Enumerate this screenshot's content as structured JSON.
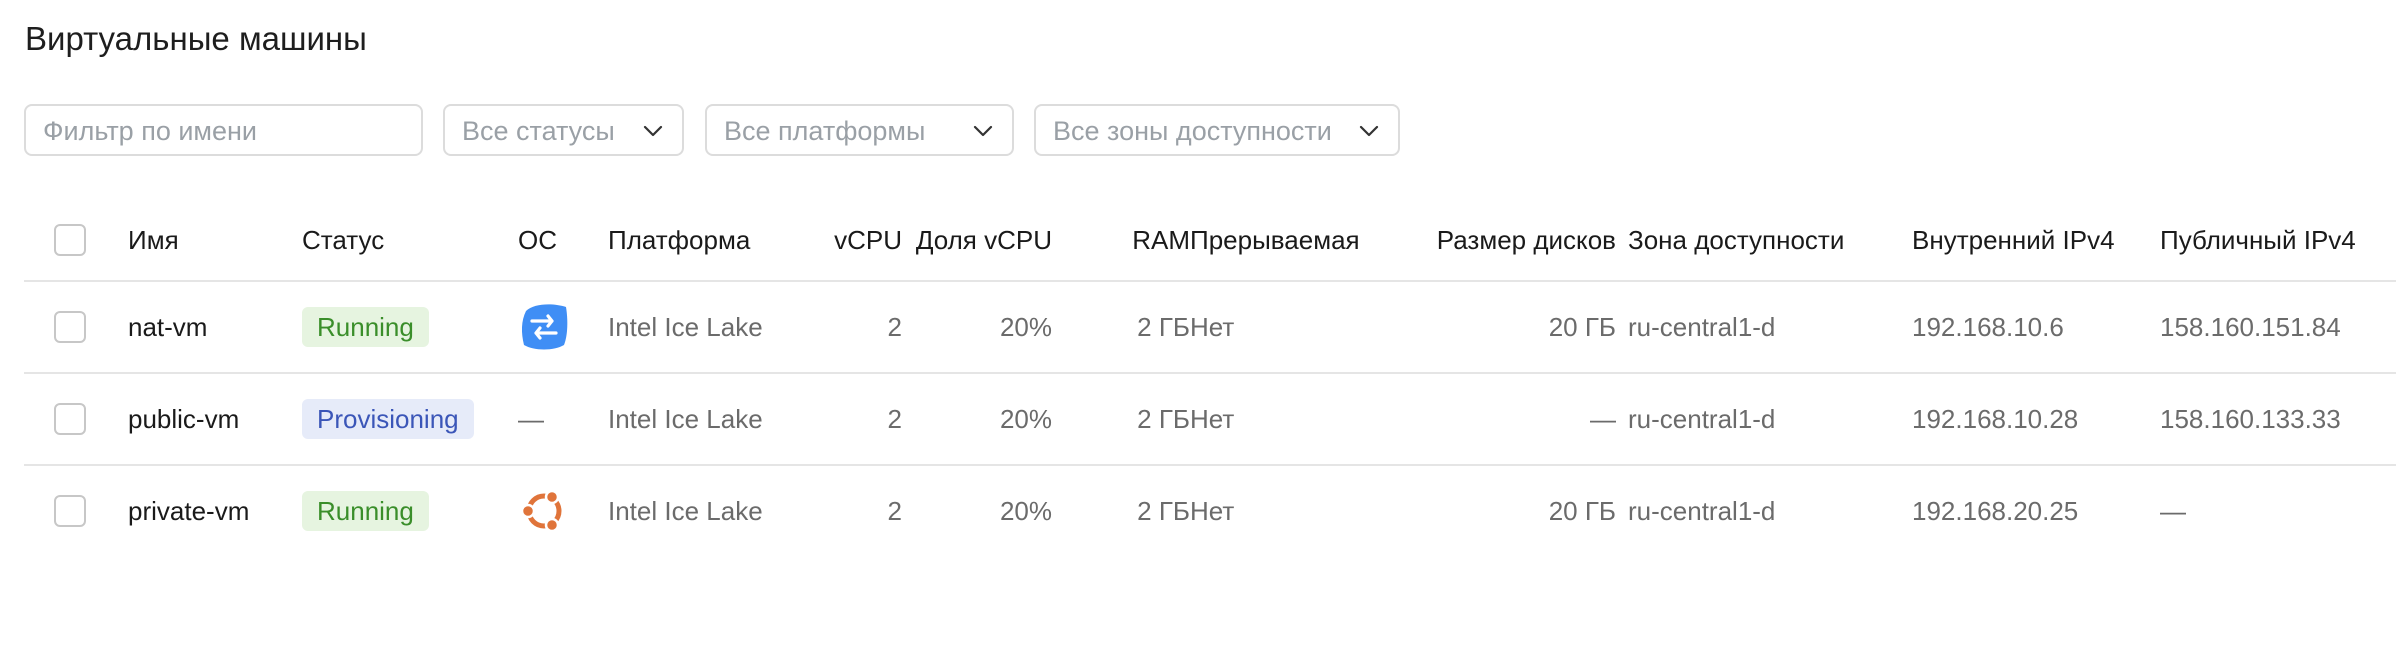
{
  "page": {
    "title": "Виртуальные машины"
  },
  "filters": {
    "name_placeholder": "Фильтр по имени",
    "status": "Все статусы",
    "platform": "Все платформы",
    "zone": "Все зоны доступности"
  },
  "table": {
    "headers": {
      "name": "Имя",
      "status": "Статус",
      "os": "ОС",
      "platform": "Платформа",
      "vcpu": "vCPU",
      "vcpu_share": "Доля vCPU",
      "ram": "RAM",
      "preemptible": "Прерываемая",
      "disk_size": "Размер дисков",
      "zone": "Зона доступности",
      "internal_ipv4": "Внутренний IPv4",
      "public_ipv4": "Публичный IPv4"
    },
    "rows": [
      {
        "name": "nat-vm",
        "status": "Running",
        "status_color": "#3a8e2a",
        "status_bg": "#e6f4e0",
        "os_icon": "nat-instance-arrows-icon",
        "os_text": "",
        "platform": "Intel Ice Lake",
        "vcpu": "2",
        "vcpu_share": "20%",
        "ram": "2 ГБ",
        "preemptible": "Нет",
        "disk_size": "20 ГБ",
        "zone": "ru-central1-d",
        "internal_ipv4": "192.168.10.6",
        "public_ipv4": "158.160.151.84"
      },
      {
        "name": "public-vm",
        "status": "Provisioning",
        "status_color": "#3b56b8",
        "status_bg": "#e6ebf9",
        "os_icon": "",
        "os_text": "—",
        "platform": "Intel Ice Lake",
        "vcpu": "2",
        "vcpu_share": "20%",
        "ram": "2 ГБ",
        "preemptible": "Нет",
        "disk_size": "—",
        "zone": "ru-central1-d",
        "internal_ipv4": "192.168.10.28",
        "public_ipv4": "158.160.133.33"
      },
      {
        "name": "private-vm",
        "status": "Running",
        "status_color": "#3a8e2a",
        "status_bg": "#e6f4e0",
        "os_icon": "ubuntu-icon",
        "os_text": "",
        "platform": "Intel Ice Lake",
        "vcpu": "2",
        "vcpu_share": "20%",
        "ram": "2 ГБ",
        "preemptible": "Нет",
        "disk_size": "20 ГБ",
        "zone": "ru-central1-d",
        "internal_ipv4": "192.168.20.25",
        "public_ipv4": "—"
      }
    ]
  },
  "colors": {
    "running": "#3a8e2a",
    "provisioning": "#3b56b8",
    "nat_icon": "#3f8ef5",
    "ubuntu_icon": "#e0743a"
  }
}
